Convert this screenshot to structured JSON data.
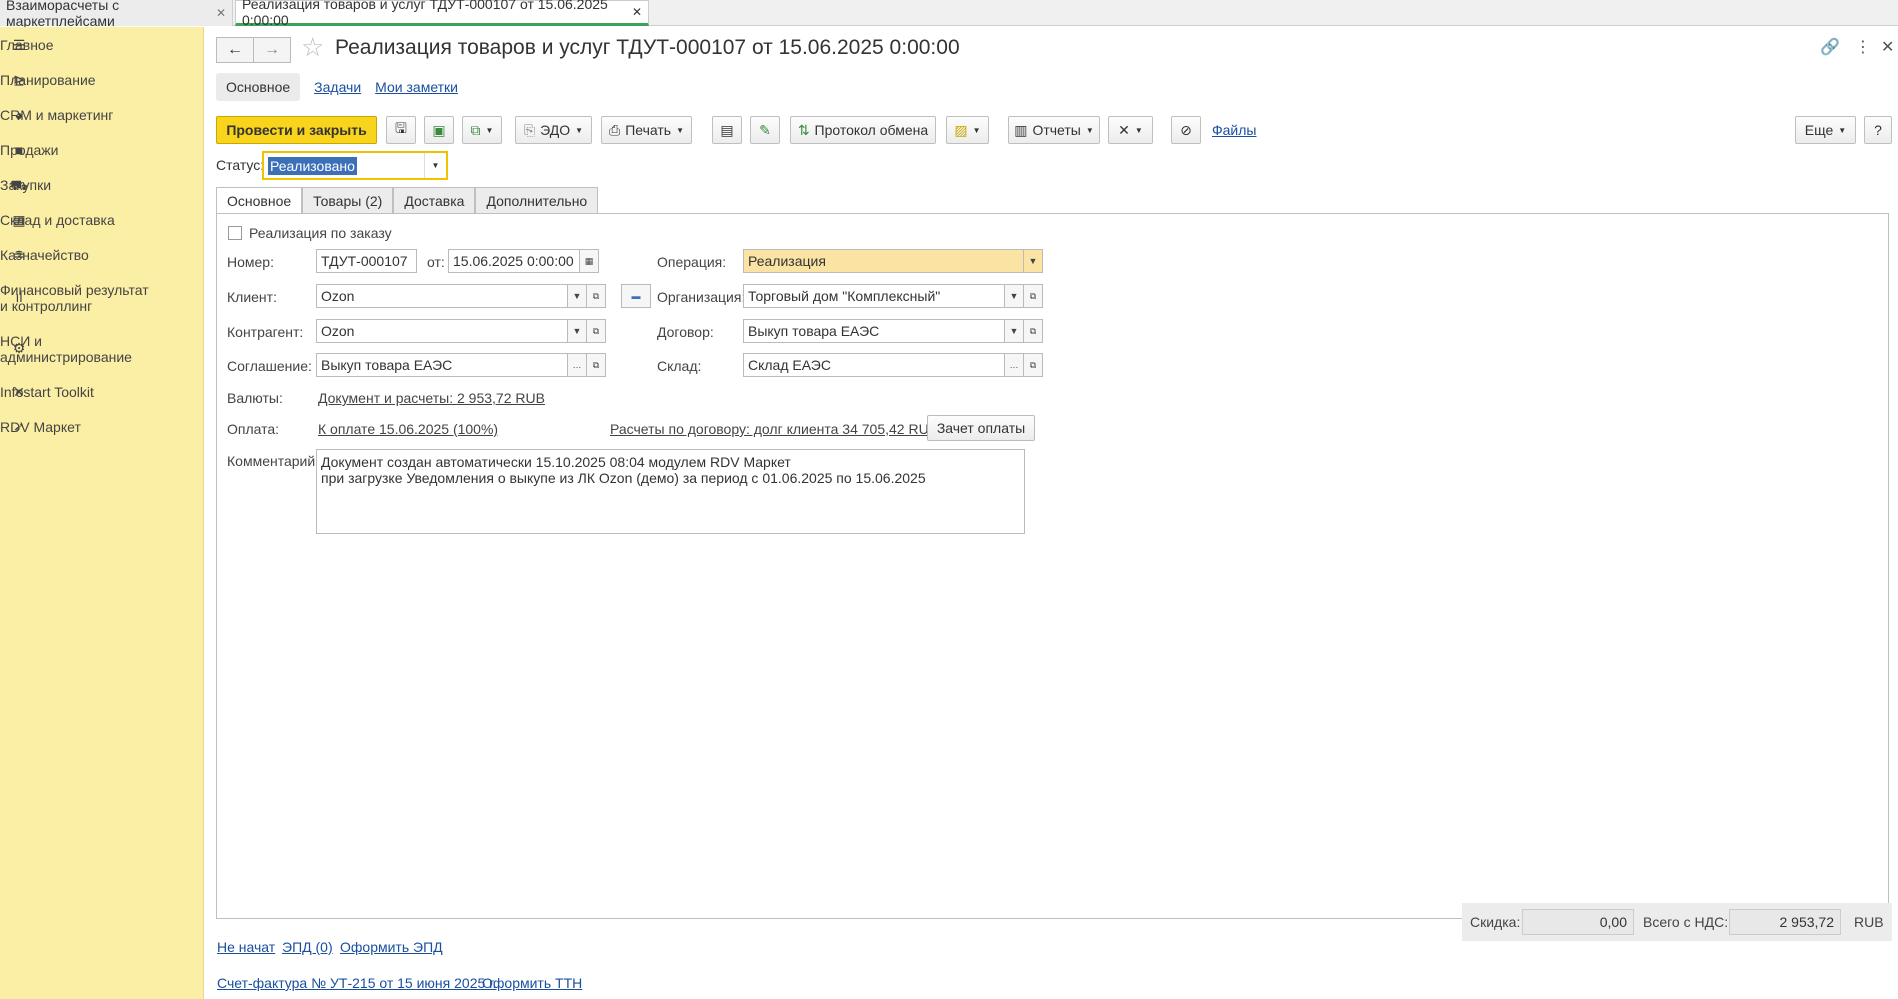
{
  "tabs": [
    {
      "label": "Взаиморасчеты с маркетплейсами"
    },
    {
      "label": "Реализация товаров и услуг ТДУТ-000107 от 15.06.2025 0:00:00"
    }
  ],
  "sidebar": {
    "items": [
      {
        "label": "Главное",
        "icon": "menu-icon"
      },
      {
        "label": "Планирование",
        "icon": "planning-icon"
      },
      {
        "label": "CRM и маркетинг",
        "icon": "pie-icon"
      },
      {
        "label": "Продажи",
        "icon": "bag-icon"
      },
      {
        "label": "Закупки",
        "icon": "cart-icon"
      },
      {
        "label": "Склад и доставка",
        "icon": "grid-icon"
      },
      {
        "label": "Казначейство",
        "icon": "coins-icon"
      },
      {
        "label": "Финансовый результат и контроллинг",
        "icon": "bars-icon"
      },
      {
        "label": "НСИ и администрирование",
        "icon": "gear-icon"
      },
      {
        "label": "Infostart Toolkit",
        "icon": "tools-icon"
      },
      {
        "label": "RDV Маркет",
        "icon": "rocket-icon"
      }
    ]
  },
  "header": {
    "title": "Реализация товаров и услуг ТДУТ-000107 от 15.06.2025 0:00:00"
  },
  "subnav": {
    "main": "Основное",
    "tasks": "Задачи",
    "notes": "Мои заметки"
  },
  "toolbar": {
    "post_close": "Провести и закрыть",
    "edo": "ЭДО",
    "print": "Печать",
    "exchange_protocol": "Протокол обмена",
    "reports": "Отчеты",
    "files": "Файлы",
    "more": "Еще",
    "help": "?"
  },
  "status": {
    "label": "Статус:",
    "value": "Реализовано"
  },
  "form_tabs": [
    "Основное",
    "Товары (2)",
    "Доставка",
    "Дополнительно"
  ],
  "form": {
    "by_order_label": "Реализация по заказу",
    "number_label": "Номер:",
    "number_value": "ТДУТ-000107",
    "from_label": "от:",
    "date_value": "15.06.2025  0:00:00",
    "operation_label": "Операция:",
    "operation_value": "Реализация",
    "client_label": "Клиент:",
    "client_value": "Ozon",
    "org_label": "Организация:",
    "org_value": "Торговый дом \"Комплексный\"",
    "contractor_label": "Контрагент:",
    "contractor_value": "Ozon",
    "contract_label": "Договор:",
    "contract_value": "Выкуп товара ЕАЭС",
    "agreement_label": "Соглашение:",
    "agreement_value": "Выкуп товара ЕАЭС",
    "warehouse_label": "Склад:",
    "warehouse_value": "Склад ЕАЭС",
    "currency_label": "Валюты:",
    "currency_link": "Документ и расчеты: 2 953,72 RUB",
    "payment_label": "Оплата:",
    "payment_link": "К оплате 15.06.2025 (100%)",
    "contract_settlements_link": "Расчеты по договору: долг клиента 34 705,42 RUB",
    "offset_button": "Зачет оплаты",
    "comment_label": "Комментарий:",
    "comment_line1": "Документ создан автоматически 15.10.2025 08:04 модулем RDV Маркет",
    "comment_line2": "при загрузке Уведомления о выкупе  из ЛК Ozon (демо) за период с 01.06.2025 по 15.06.2025"
  },
  "footer": {
    "not_started": "Не начат",
    "epd": "ЭПД (0)",
    "make_epd": "Оформить ЭПД",
    "invoice": "Счет-фактура № УТ-215 от 15 июня 2025 г.",
    "make_ttn": "Оформить ТТН",
    "discount_label": "Скидка:",
    "discount_value": "0,00",
    "total_label": "Всего с НДС:",
    "total_value": "2 953,72",
    "currency": "RUB"
  }
}
